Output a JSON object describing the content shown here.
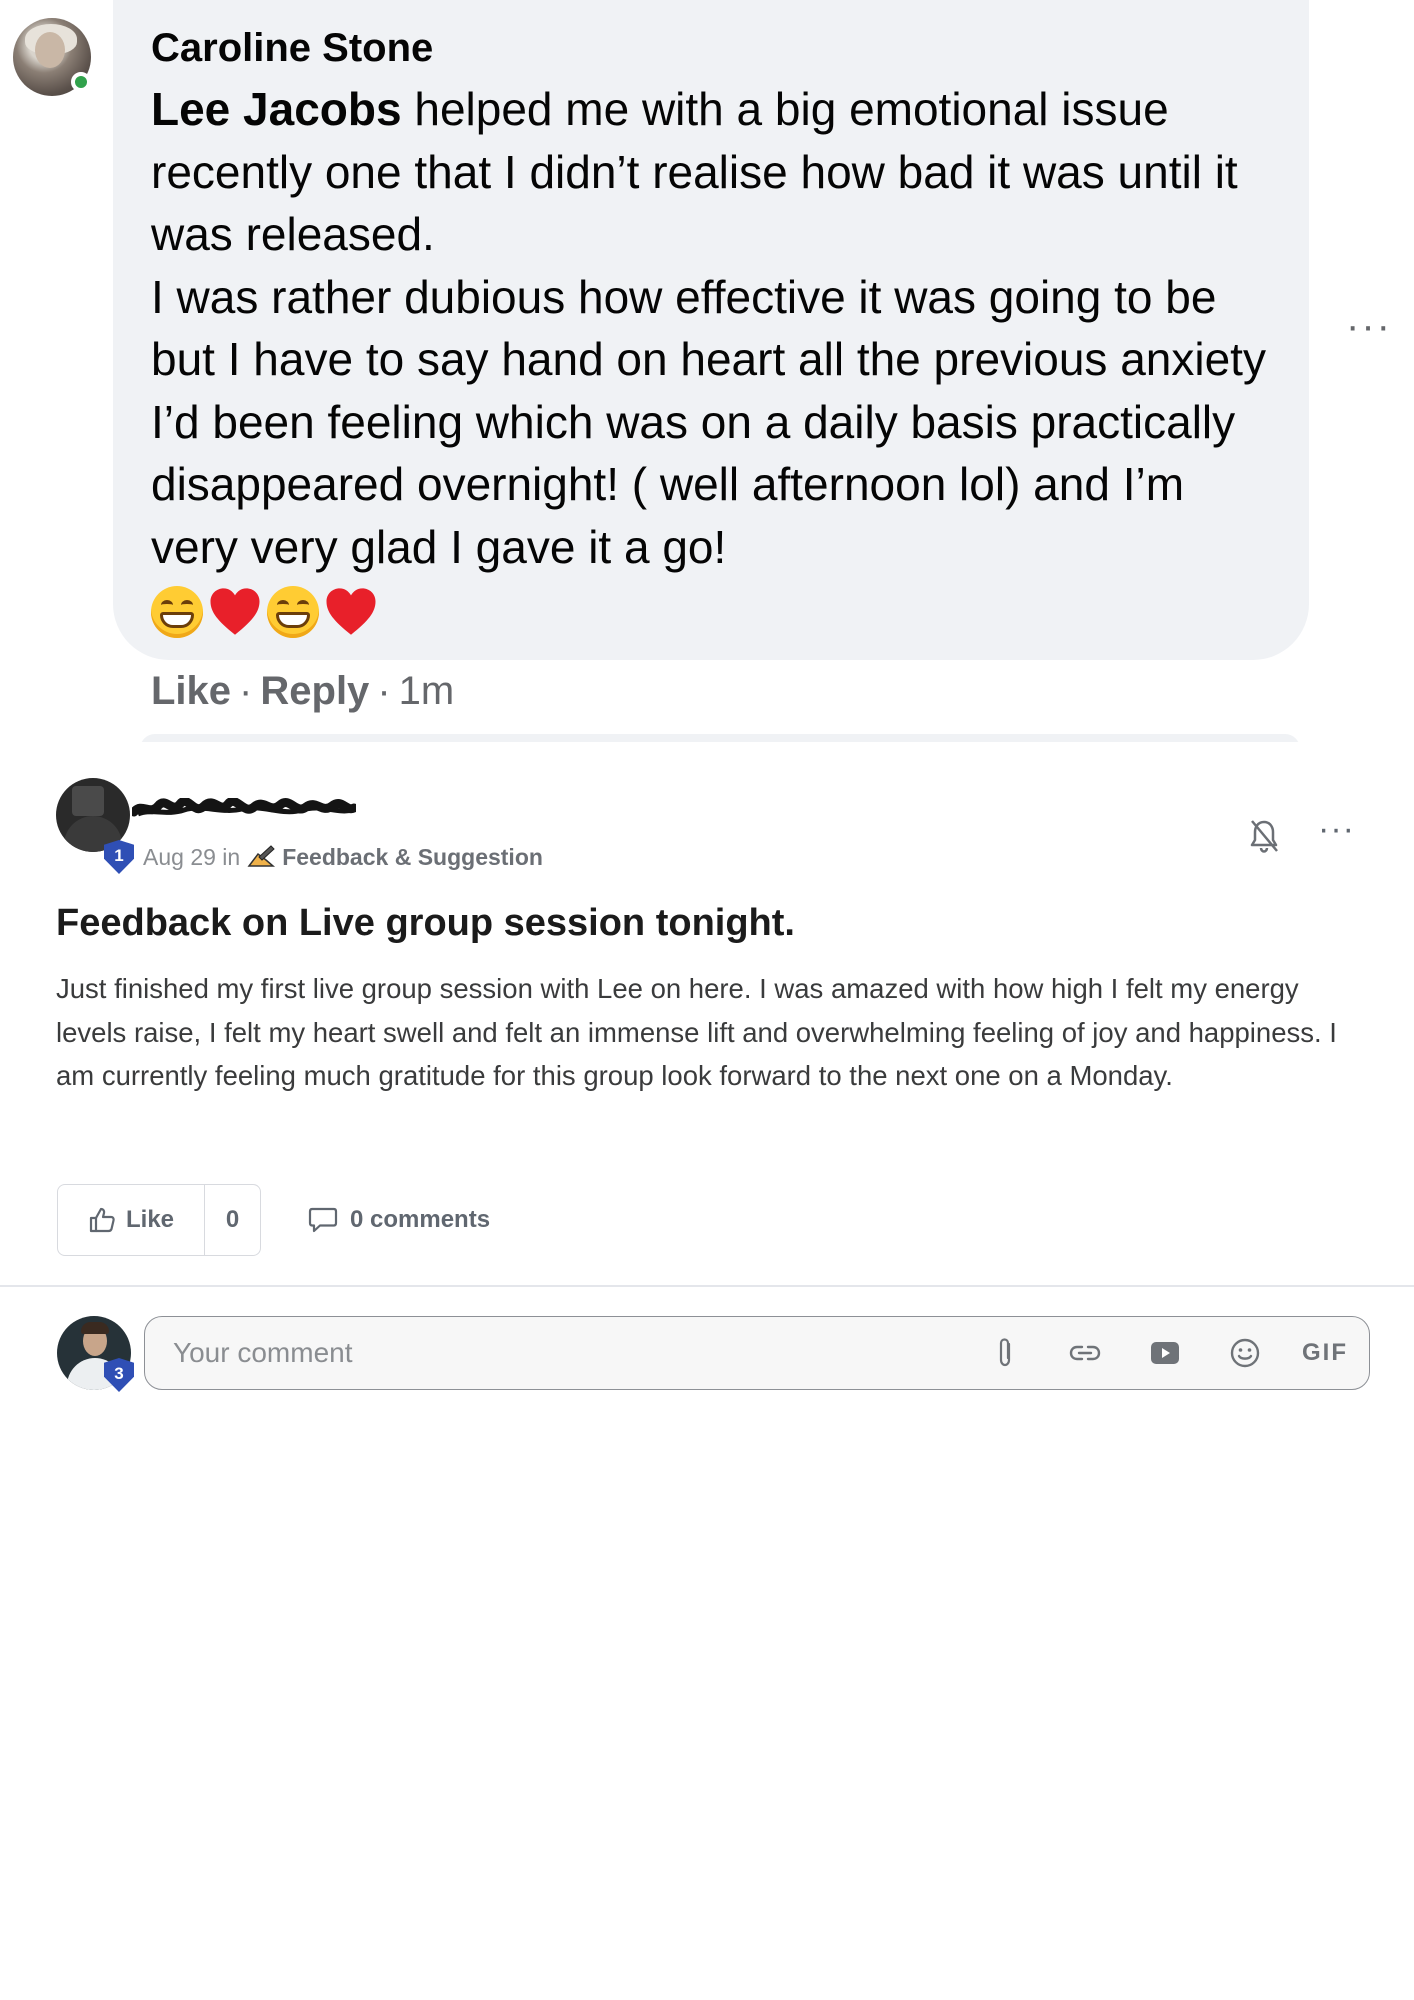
{
  "facebook_comment": {
    "author": "Caroline Stone",
    "mention": "Lee Jacobs",
    "paragraph_1": " helped me with a big emotional issue recently one that I didn’t realise how bad it was until it was released.",
    "paragraph_2": "I was rather dubious how effective it was going to be but I have to say hand on heart all the previous anxiety I’d been feeling which was on a daily basis practically disappeared overnight! ( well afternoon lol) and I’m very very glad I gave it a go!",
    "emojis": [
      "grinning-face",
      "red-heart",
      "grinning-face",
      "red-heart"
    ],
    "actions": {
      "like": "Like",
      "sep": "·",
      "reply": "Reply",
      "time": "1m"
    },
    "more": "···"
  },
  "post": {
    "meta_date": "Aug 29 in",
    "category": "Feedback & Suggestion",
    "title": "Feedback on Live group session tonight.",
    "body": "Just finished my first live group session with Lee on here. I was amazed with how high I felt my energy levels raise, I felt my heart swell and felt an immense lift and overwhelming feeling of joy and happiness. I am currently feeling much gratitude for this group look forward to the next one on a Monday.",
    "like_label": "Like",
    "like_count": "0",
    "comments_label": "0 comments",
    "more": "···",
    "author_level": "1"
  },
  "comment_input": {
    "placeholder": "Your comment",
    "user_level": "3",
    "gif_label": "GIF"
  },
  "colors": {
    "fb_bubble": "#f0f2f5",
    "online_green": "#31a24c",
    "level_badge_blue": "#2f4fb5"
  }
}
